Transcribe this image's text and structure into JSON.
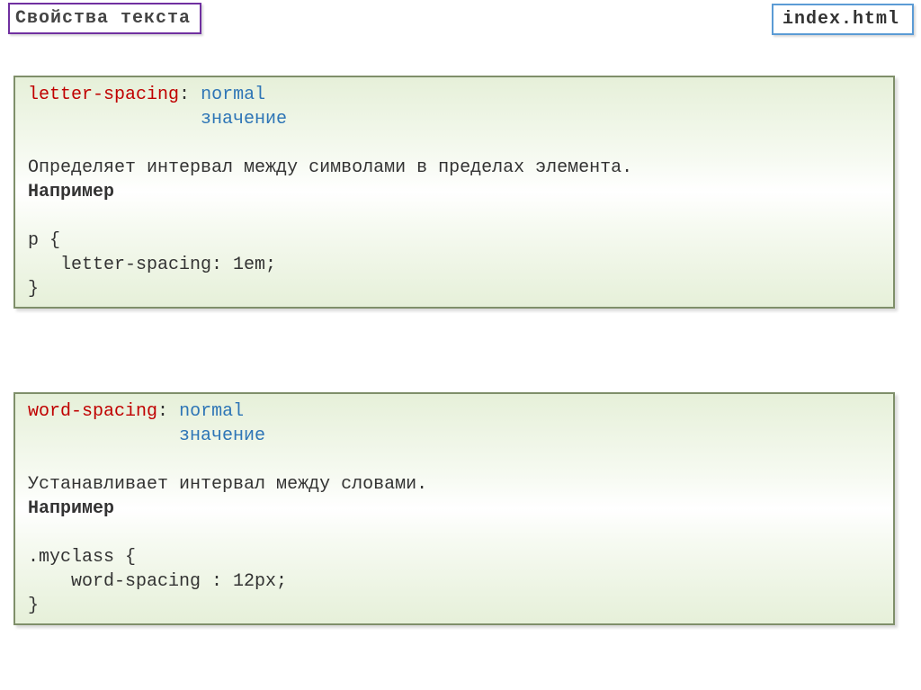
{
  "header": {
    "title": "Свойства текста",
    "filename": "index.html"
  },
  "box1": {
    "property": "letter-spacing",
    "value1": "normal",
    "value2": "значение",
    "desc": "Определяет интервал между символами в пределах элемента.",
    "example_label": "Например",
    "code_line1": "p {",
    "code_line2": "    letter-spacing: 1em;",
    "code_line3": " }"
  },
  "box2": {
    "property": "word-spacing",
    "value1": "normal",
    "value2": "значение",
    "desc": "Устанавливает интервал между словами.",
    "example_label": "Например",
    "code_line1": ".myclass {",
    "code_line2": "     word-spacing : 12px;",
    "code_line3": "}"
  }
}
